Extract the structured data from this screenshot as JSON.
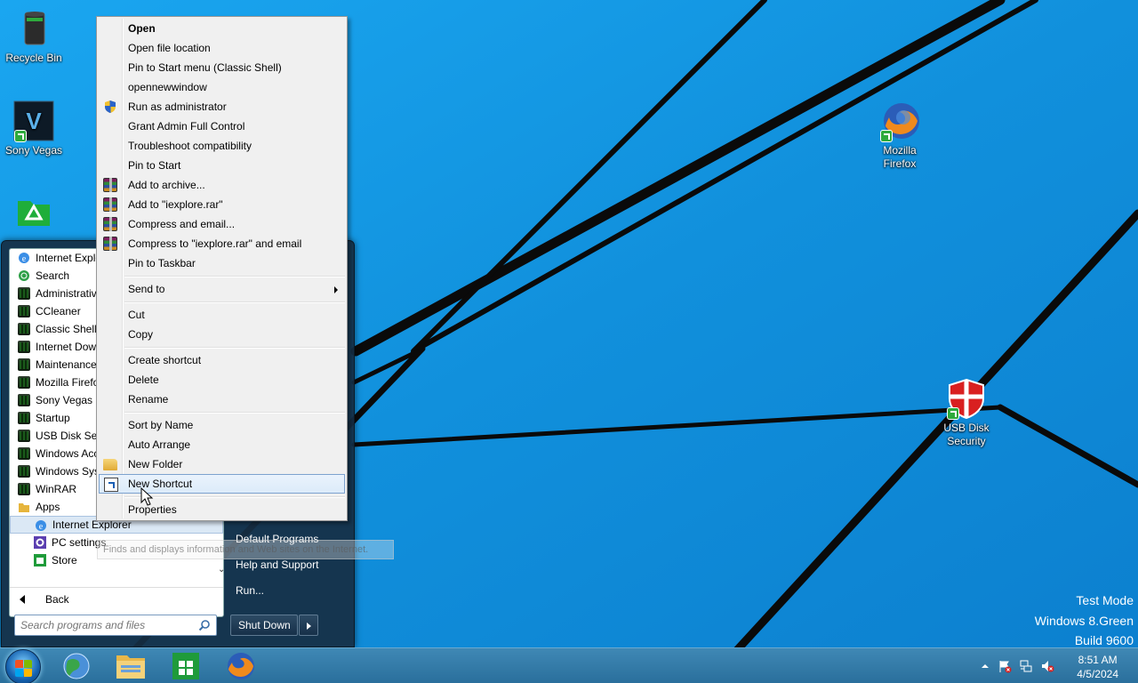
{
  "desktop": {
    "icons": [
      {
        "id": "recycle-bin",
        "label": "Recycle Bin"
      },
      {
        "id": "sony-vegas",
        "label": "Sony Vegas"
      },
      {
        "id": "unknown-green",
        "label": ""
      },
      {
        "id": "mozilla-firefox",
        "label": "Mozilla Firefox"
      },
      {
        "id": "usb-disk-security",
        "label": "USB Disk Security"
      }
    ],
    "watermark": {
      "line1": "Test Mode",
      "line2": "Windows 8.Green",
      "line3": "Build 9600"
    }
  },
  "context_menu": {
    "items": {
      "open": "Open",
      "open_file_location": "Open file location",
      "pin_classic": "Pin to Start menu (Classic Shell)",
      "opennewwindow": "opennewwindow",
      "run_as_admin": "Run as administrator",
      "grant_admin": "Grant Admin Full Control",
      "troubleshoot": "Troubleshoot compatibility",
      "pin_start": "Pin to Start",
      "add_archive": "Add to archive...",
      "add_iexplore_rar": "Add to \"iexplore.rar\"",
      "compress_email": "Compress and email...",
      "compress_iexplore_email": "Compress to \"iexplore.rar\" and email",
      "pin_taskbar": "Pin to Taskbar",
      "send_to": "Send to",
      "cut": "Cut",
      "copy": "Copy",
      "create_shortcut": "Create shortcut",
      "delete": "Delete",
      "rename": "Rename",
      "sort_by_name": "Sort by Name",
      "auto_arrange": "Auto Arrange",
      "new_folder": "New Folder",
      "new_shortcut": "New Shortcut",
      "properties": "Properties"
    }
  },
  "start_menu": {
    "programs": [
      "Internet Explo",
      "Search",
      "Administrativ",
      "CCleaner",
      "Classic Shell",
      "Internet Down",
      "Maintenance",
      "Mozilla Firefo",
      "Sony Vegas",
      "Startup",
      "USB Disk Secu",
      "Windows Acc",
      "Windows Syst",
      "WinRAR",
      "Apps"
    ],
    "apps": [
      "Internet Explorer",
      "PC settings",
      "Store"
    ],
    "back": "Back",
    "search_placeholder": "Search programs and files",
    "right_links": {
      "default_programs": "Default Programs",
      "help_support": "Help and Support",
      "run": "Run..."
    },
    "shutdown": "Shut Down",
    "tooltip": "Finds and displays information and Web sites on the Internet."
  },
  "taskbar": {
    "clock_time": "8:51 AM",
    "clock_date": "4/5/2024"
  }
}
